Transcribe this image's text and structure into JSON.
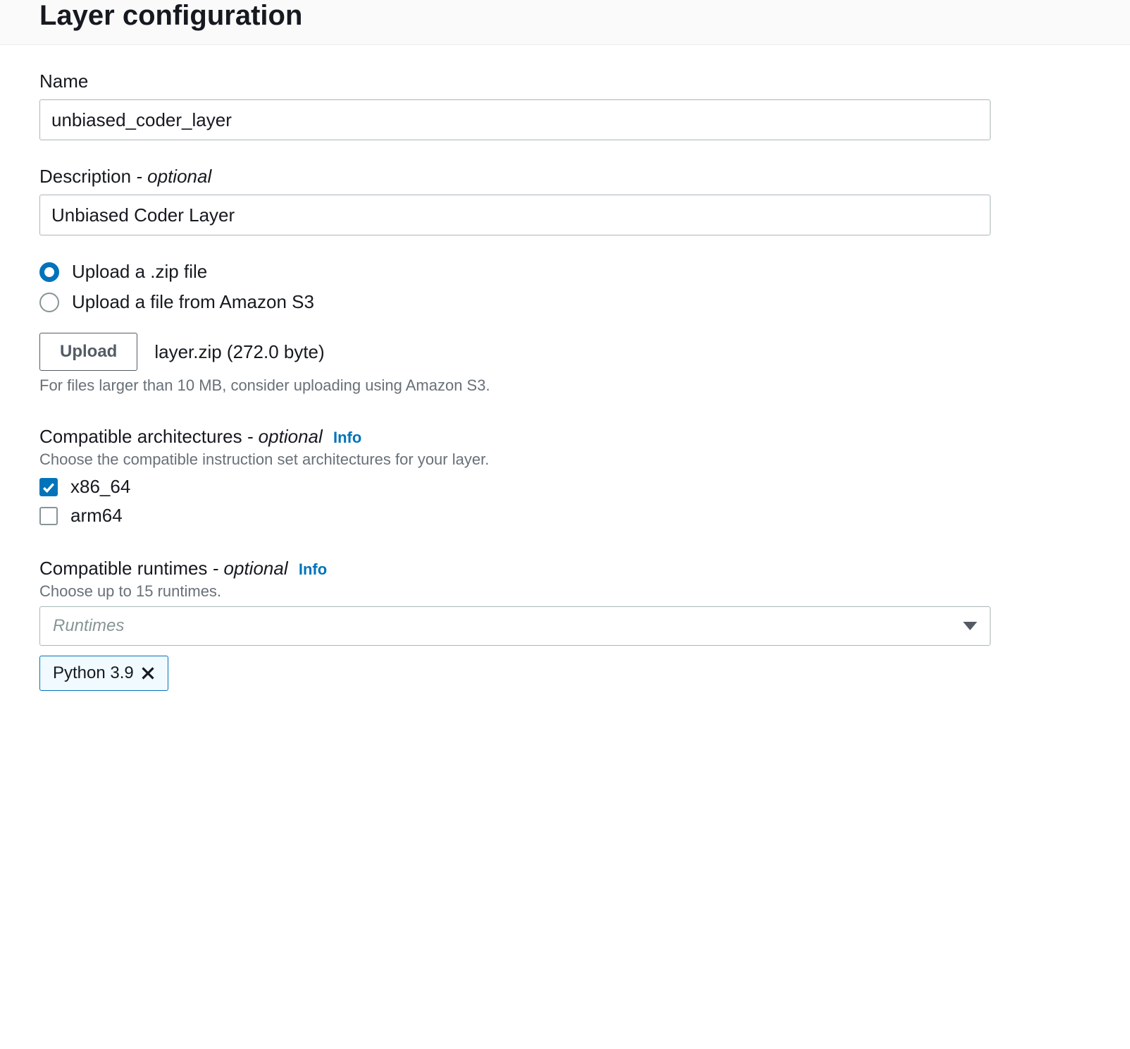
{
  "header": {
    "title": "Layer configuration"
  },
  "name": {
    "label": "Name",
    "value": "unbiased_coder_layer"
  },
  "description": {
    "label": "Description",
    "optional": " - optional",
    "value": "Unbiased Coder Layer"
  },
  "upload": {
    "option_zip": "Upload a .zip file",
    "option_s3": "Upload a file from Amazon S3",
    "button": "Upload",
    "filename": "layer.zip (272.0 byte)",
    "hint": "For files larger than 10 MB, consider uploading using Amazon S3."
  },
  "arch": {
    "title": "Compatible architectures",
    "optional": " - optional",
    "info": "Info",
    "desc": "Choose the compatible instruction set architectures for your layer.",
    "x86": "x86_64",
    "arm": "arm64"
  },
  "runtimes": {
    "title": "Compatible runtimes",
    "optional": " - optional",
    "info": "Info",
    "desc": "Choose up to 15 runtimes.",
    "placeholder": "Runtimes",
    "token": "Python 3.9"
  }
}
